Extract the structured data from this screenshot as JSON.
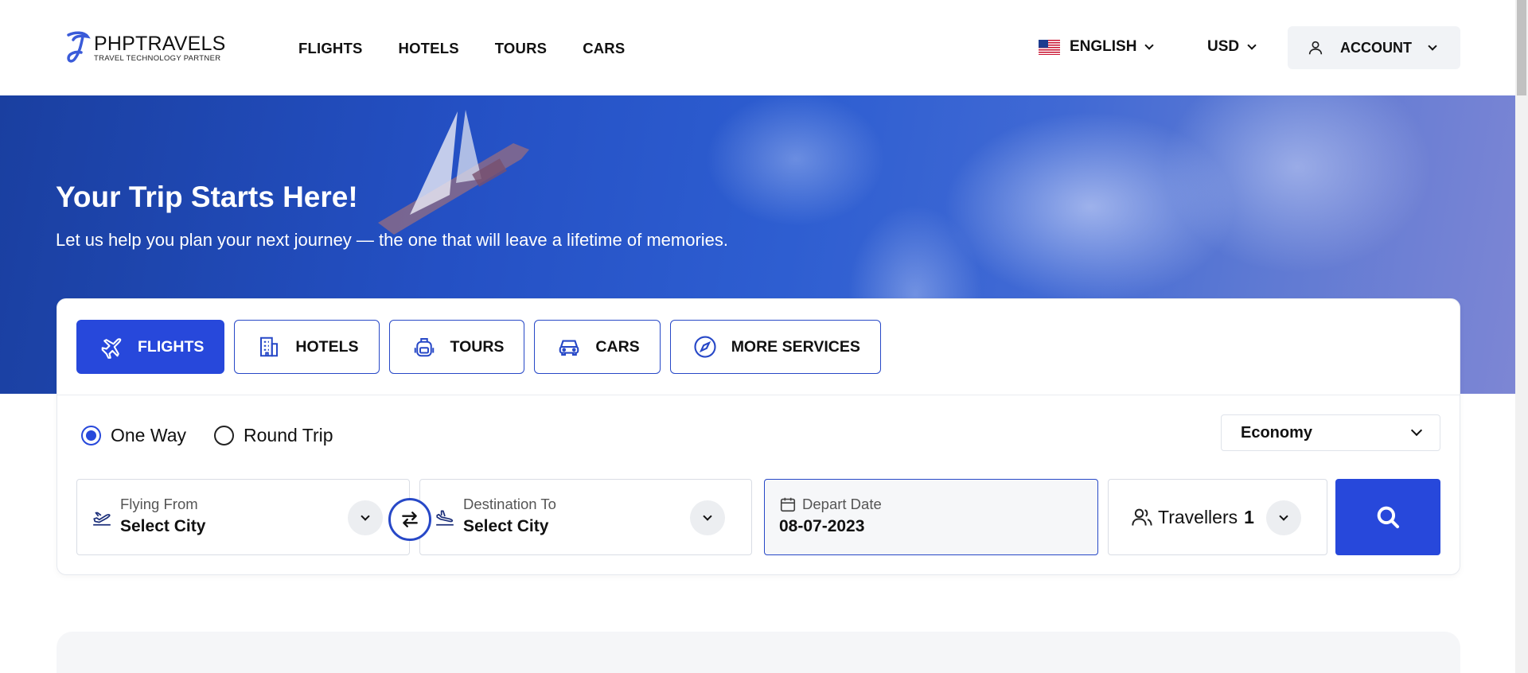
{
  "brand": {
    "name": "PHPTRAVELS",
    "tagline": "TRAVEL TECHNOLOGY PARTNER"
  },
  "nav": [
    {
      "label": "FLIGHTS"
    },
    {
      "label": "HOTELS"
    },
    {
      "label": "TOURS"
    },
    {
      "label": "CARS"
    }
  ],
  "header": {
    "language": "ENGLISH",
    "currency": "USD",
    "account": "ACCOUNT"
  },
  "hero": {
    "title": "Your Trip Starts Here!",
    "subtitle": "Let us help you plan your next journey — the one that will leave a lifetime of memories."
  },
  "tabs": [
    {
      "label": "FLIGHTS",
      "icon": "plane-icon",
      "active": true
    },
    {
      "label": "HOTELS",
      "icon": "building-icon",
      "active": false
    },
    {
      "label": "TOURS",
      "icon": "backpack-icon",
      "active": false
    },
    {
      "label": "CARS",
      "icon": "car-icon",
      "active": false
    },
    {
      "label": "MORE SERVICES",
      "icon": "compass-icon",
      "active": false
    }
  ],
  "trip_type": {
    "one_way": "One Way",
    "round_trip": "Round Trip",
    "selected": "One Way"
  },
  "cabin_class": "Economy",
  "search": {
    "from": {
      "label": "Flying From",
      "value": "Select City"
    },
    "to": {
      "label": "Destination To",
      "value": "Select City"
    },
    "date": {
      "label": "Depart Date",
      "value": "08-07-2023"
    },
    "travellers": {
      "label": "Travellers",
      "count": "1"
    }
  },
  "colors": {
    "primary": "#2748db",
    "accent_border": "#2748c7"
  }
}
